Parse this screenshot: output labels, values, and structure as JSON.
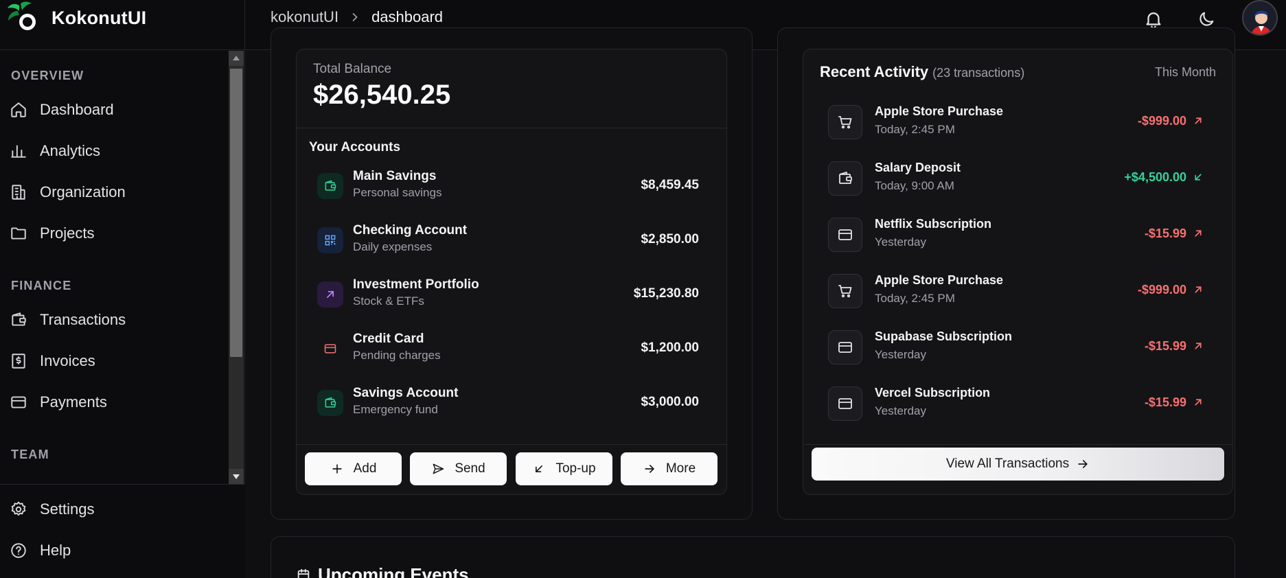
{
  "brand": {
    "name": "KokonutUI",
    "accent": "#22c55e"
  },
  "breadcrumb": {
    "root": "kokonutUI",
    "current": "dashboard"
  },
  "sidebar": {
    "sections": [
      {
        "label": "OVERVIEW",
        "items": [
          {
            "label": "Dashboard",
            "icon": "home-icon"
          },
          {
            "label": "Analytics",
            "icon": "bar-chart-icon"
          },
          {
            "label": "Organization",
            "icon": "building-icon"
          },
          {
            "label": "Projects",
            "icon": "folder-icon"
          }
        ]
      },
      {
        "label": "FINANCE",
        "items": [
          {
            "label": "Transactions",
            "icon": "wallet-icon"
          },
          {
            "label": "Invoices",
            "icon": "receipt-icon"
          },
          {
            "label": "Payments",
            "icon": "credit-card-icon"
          }
        ]
      },
      {
        "label": "TEAM",
        "items": []
      }
    ],
    "bottom": [
      {
        "label": "Settings",
        "icon": "gear-icon"
      },
      {
        "label": "Help",
        "icon": "help-circle-icon"
      }
    ]
  },
  "balance": {
    "label": "Total Balance",
    "value": "$26,540.25"
  },
  "accounts": {
    "title": "Your Accounts",
    "items": [
      {
        "name": "Main Savings",
        "sub": "Personal savings",
        "amount": "$8,459.45",
        "icon": "wallet-icon",
        "color": "#34d399"
      },
      {
        "name": "Checking Account",
        "sub": "Daily expenses",
        "amount": "$2,850.00",
        "icon": "qr-code-icon",
        "color": "#60a5fa"
      },
      {
        "name": "Investment Portfolio",
        "sub": "Stock & ETFs",
        "amount": "$15,230.80",
        "icon": "arrow-up-right-icon",
        "color": "#c084fc"
      },
      {
        "name": "Credit Card",
        "sub": "Pending charges",
        "amount": "$1,200.00",
        "icon": "credit-card-icon",
        "color": "#f87171"
      },
      {
        "name": "Savings Account",
        "sub": "Emergency fund",
        "amount": "$3,000.00",
        "icon": "wallet-icon",
        "color": "#34d399"
      }
    ]
  },
  "actions": [
    {
      "label": "Add",
      "icon": "plus-icon"
    },
    {
      "label": "Send",
      "icon": "send-icon"
    },
    {
      "label": "Top-up",
      "icon": "arrow-down-left-icon"
    },
    {
      "label": "More",
      "icon": "arrow-right-icon"
    }
  ],
  "recent_activity": {
    "title": "Recent Activity",
    "count": "(23 transactions)",
    "period": "This Month",
    "items": [
      {
        "name": "Apple Store Purchase",
        "time": "Today, 2:45 PM",
        "amount": "-$999.00",
        "type": "debit",
        "icon": "shopping-cart-icon"
      },
      {
        "name": "Salary Deposit",
        "time": "Today, 9:00 AM",
        "amount": "+$4,500.00",
        "type": "credit",
        "icon": "wallet-icon"
      },
      {
        "name": "Netflix Subscription",
        "time": "Yesterday",
        "amount": "-$15.99",
        "type": "debit",
        "icon": "credit-card-icon"
      },
      {
        "name": "Apple Store Purchase",
        "time": "Today, 2:45 PM",
        "amount": "-$999.00",
        "type": "debit",
        "icon": "shopping-cart-icon"
      },
      {
        "name": "Supabase Subscription",
        "time": "Yesterday",
        "amount": "-$15.99",
        "type": "debit",
        "icon": "credit-card-icon"
      },
      {
        "name": "Vercel Subscription",
        "time": "Yesterday",
        "amount": "-$15.99",
        "type": "debit",
        "icon": "credit-card-icon"
      }
    ],
    "view_all_label": "View All Transactions",
    "debit_color": "#f87171",
    "credit_color": "#34d399"
  },
  "events": {
    "title": "Upcoming Events"
  }
}
